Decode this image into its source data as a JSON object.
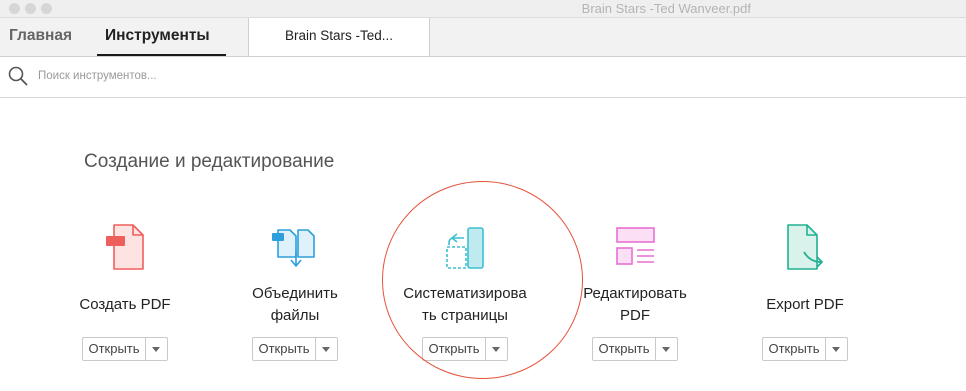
{
  "window": {
    "title": "Brain Stars -Ted Wanveer.pdf"
  },
  "tabs": {
    "home": "Главная",
    "tools": "Инструменты",
    "document": "Brain Stars -Ted..."
  },
  "search": {
    "placeholder": "Поиск инструментов..."
  },
  "section": {
    "title": "Создание и редактирование"
  },
  "tools": [
    {
      "label_lines": [
        "Создать PDF"
      ],
      "icon": "create-pdf-icon",
      "color": "#ee5f5b",
      "button": "Открыть"
    },
    {
      "label_lines": [
        "Объединить",
        "файлы"
      ],
      "icon": "combine-files-icon",
      "color": "#2d9fdc",
      "button": "Открыть"
    },
    {
      "label_lines": [
        "Систематизирова",
        "ть страницы"
      ],
      "icon": "organize-pages-icon",
      "color": "#3ebfd0",
      "button": "Открыть"
    },
    {
      "label_lines": [
        "Редактировать",
        "PDF"
      ],
      "icon": "edit-pdf-icon",
      "color": "#ea6fd4",
      "button": "Открыть"
    },
    {
      "label_lines": [
        "Export PDF"
      ],
      "icon": "export-pdf-icon",
      "color": "#20b191",
      "button": "Открыть"
    }
  ],
  "annotation": {
    "highlighted_tool": "organize-pages",
    "color": "#e5533b"
  }
}
